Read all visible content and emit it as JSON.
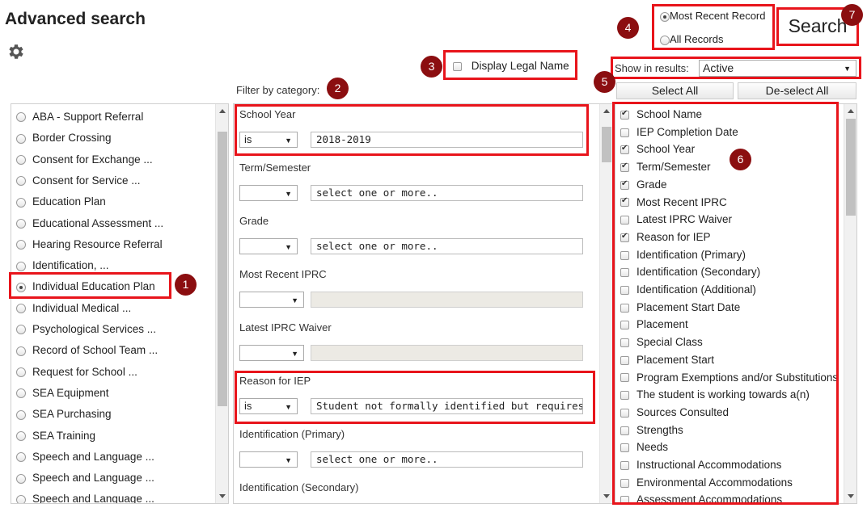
{
  "page": {
    "title": "Advanced search"
  },
  "icons": {
    "settings": "gear-icon"
  },
  "colors": {
    "highlight": "#e8141b",
    "marker": "#8b0e10"
  },
  "record_mode": {
    "options": [
      {
        "label": "Most Recent Record",
        "selected": true
      },
      {
        "label": "All Records",
        "selected": false
      }
    ]
  },
  "search_button": {
    "label": "Search"
  },
  "display_legal_name": {
    "label": "Display Legal Name",
    "checked": false
  },
  "filter": {
    "heading": "Filter by category:"
  },
  "show_in_results": {
    "label": "Show in results:",
    "value": "Active"
  },
  "select_all": {
    "label": "Select All"
  },
  "deselect_all": {
    "label": "De-select All"
  },
  "markers": [
    "1",
    "2",
    "3",
    "4",
    "5",
    "6",
    "7"
  ],
  "categories": [
    {
      "label": "ABA - Support Referral",
      "selected": false
    },
    {
      "label": "Border Crossing",
      "selected": false
    },
    {
      "label": "Consent for Exchange ...",
      "selected": false
    },
    {
      "label": "Consent for Service ...",
      "selected": false
    },
    {
      "label": "Education Plan",
      "selected": false
    },
    {
      "label": "Educational Assessment ...",
      "selected": false
    },
    {
      "label": "Hearing Resource Referral",
      "selected": false
    },
    {
      "label": "Identification, ...",
      "selected": false
    },
    {
      "label": "Individual Education Plan",
      "selected": true
    },
    {
      "label": "Individual Medical ...",
      "selected": false
    },
    {
      "label": "Psychological Services ...",
      "selected": false
    },
    {
      "label": "Record of School Team ...",
      "selected": false
    },
    {
      "label": "Request for School ...",
      "selected": false
    },
    {
      "label": "SEA Equipment",
      "selected": false
    },
    {
      "label": "SEA Purchasing",
      "selected": false
    },
    {
      "label": "SEA Training",
      "selected": false
    },
    {
      "label": "Speech and Language ...",
      "selected": false
    },
    {
      "label": "Speech and Language ...",
      "selected": false
    },
    {
      "label": "Speech and Language ...",
      "selected": false
    }
  ],
  "filters": [
    {
      "label": "School Year",
      "operator": "is",
      "value": "2018-2019",
      "disabled": false
    },
    {
      "label": "Term/Semester",
      "operator": "",
      "value": "select one or more..",
      "disabled": false
    },
    {
      "label": "Grade",
      "operator": "",
      "value": "select one or more..",
      "disabled": false
    },
    {
      "label": "Most Recent IPRC",
      "operator": "",
      "value": "",
      "disabled": true
    },
    {
      "label": "Latest IPRC Waiver",
      "operator": "",
      "value": "",
      "disabled": true
    },
    {
      "label": "Reason for IEP",
      "operator": "is",
      "value": "Student not formally identified but requires speci",
      "disabled": false
    },
    {
      "label": "Identification (Primary)",
      "operator": "",
      "value": "select one or more..",
      "disabled": false
    },
    {
      "label": "Identification (Secondary)",
      "operator": "",
      "value": "",
      "disabled": false
    }
  ],
  "results_fields": [
    {
      "label": "School Name",
      "checked": true
    },
    {
      "label": "IEP Completion Date",
      "checked": false
    },
    {
      "label": "School Year",
      "checked": true
    },
    {
      "label": "Term/Semester",
      "checked": true
    },
    {
      "label": "Grade",
      "checked": true
    },
    {
      "label": "Most Recent IPRC",
      "checked": true
    },
    {
      "label": "Latest IPRC Waiver",
      "checked": false
    },
    {
      "label": "Reason for IEP",
      "checked": true
    },
    {
      "label": "Identification (Primary)",
      "checked": false
    },
    {
      "label": "Identification (Secondary)",
      "checked": false
    },
    {
      "label": "Identification (Additional)",
      "checked": false
    },
    {
      "label": "Placement Start Date",
      "checked": false
    },
    {
      "label": "Placement",
      "checked": false
    },
    {
      "label": "Special Class",
      "checked": false
    },
    {
      "label": "Placement Start",
      "checked": false
    },
    {
      "label": "Program Exemptions and/or Substitutions",
      "checked": false
    },
    {
      "label": "The student is working towards a(n)",
      "checked": false
    },
    {
      "label": "Sources Consulted",
      "checked": false
    },
    {
      "label": "Strengths",
      "checked": false
    },
    {
      "label": "Needs",
      "checked": false
    },
    {
      "label": "Instructional Accommodations",
      "checked": false
    },
    {
      "label": "Environmental Accommodations",
      "checked": false
    },
    {
      "label": "Assessment Accommodations",
      "checked": false
    }
  ]
}
